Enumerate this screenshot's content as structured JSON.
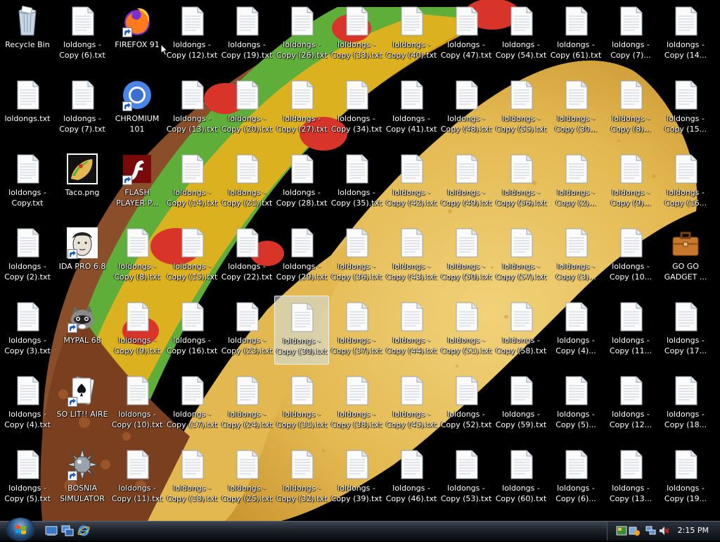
{
  "desktop": {
    "icons": [
      {
        "label": "Recycle Bin",
        "type": "bin",
        "shortcut": false,
        "col": 0,
        "row": 0
      },
      {
        "label": "loldongs -\nCopy (6).txt",
        "type": "txt",
        "shortcut": false,
        "col": 1,
        "row": 0
      },
      {
        "label": "FIREFOX 91",
        "type": "firefox",
        "shortcut": true,
        "col": 2,
        "row": 0
      },
      {
        "label": "loldongs -\nCopy (12).txt",
        "type": "txt",
        "shortcut": false,
        "col": 3,
        "row": 0
      },
      {
        "label": "loldongs -\nCopy (19).txt",
        "type": "txt",
        "shortcut": false,
        "col": 4,
        "row": 0
      },
      {
        "label": "loldongs -\nCopy (26).txt",
        "type": "txt",
        "shortcut": false,
        "col": 5,
        "row": 0
      },
      {
        "label": "loldongs -\nCopy (33).txt",
        "type": "txt",
        "shortcut": false,
        "col": 6,
        "row": 0
      },
      {
        "label": "loldongs -\nCopy (40).txt",
        "type": "txt",
        "shortcut": false,
        "col": 7,
        "row": 0
      },
      {
        "label": "loldongs -\nCopy (47).txt",
        "type": "txt",
        "shortcut": false,
        "col": 8,
        "row": 0
      },
      {
        "label": "loldongs -\nCopy (54).txt",
        "type": "txt",
        "shortcut": false,
        "col": 9,
        "row": 0
      },
      {
        "label": "loldongs -\nCopy (61).txt",
        "type": "txt",
        "shortcut": false,
        "col": 10,
        "row": 0
      },
      {
        "label": "loldongs -\nCopy (7)...",
        "type": "txt",
        "shortcut": false,
        "col": 11,
        "row": 0
      },
      {
        "label": "loldongs -\nCopy (14...",
        "type": "txt",
        "shortcut": false,
        "col": 12,
        "row": 0
      },
      {
        "label": "loldongs.txt",
        "type": "txt",
        "shortcut": false,
        "col": 0,
        "row": 1
      },
      {
        "label": "loldongs -\nCopy (7).txt",
        "type": "txt",
        "shortcut": false,
        "col": 1,
        "row": 1
      },
      {
        "label": "CHROMIUM\n101",
        "type": "chromium",
        "shortcut": true,
        "col": 2,
        "row": 1
      },
      {
        "label": "loldongs -\nCopy (13).txt",
        "type": "txt",
        "shortcut": false,
        "col": 3,
        "row": 1
      },
      {
        "label": "loldongs -\nCopy (20).txt",
        "type": "txt",
        "shortcut": false,
        "col": 4,
        "row": 1
      },
      {
        "label": "loldongs -\nCopy (27).txt",
        "type": "txt",
        "shortcut": false,
        "col": 5,
        "row": 1
      },
      {
        "label": "loldongs -\nCopy (34).txt",
        "type": "txt",
        "shortcut": false,
        "col": 6,
        "row": 1
      },
      {
        "label": "loldongs -\nCopy (41).txt",
        "type": "txt",
        "shortcut": false,
        "col": 7,
        "row": 1
      },
      {
        "label": "loldongs -\nCopy (48).txt",
        "type": "txt",
        "shortcut": false,
        "col": 8,
        "row": 1
      },
      {
        "label": "loldongs -\nCopy (55).txt",
        "type": "txt",
        "shortcut": false,
        "col": 9,
        "row": 1
      },
      {
        "label": "loldongs -\nCopy (30...",
        "type": "txt",
        "shortcut": false,
        "col": 10,
        "row": 1
      },
      {
        "label": "loldongs -\nCopy (8)...",
        "type": "txt",
        "shortcut": false,
        "col": 11,
        "row": 1
      },
      {
        "label": "loldongs -\nCopy (15...",
        "type": "txt",
        "shortcut": false,
        "col": 12,
        "row": 1
      },
      {
        "label": "loldongs -\nCopy.txt",
        "type": "txt",
        "shortcut": false,
        "col": 0,
        "row": 2
      },
      {
        "label": "Taco.png",
        "type": "taco",
        "shortcut": false,
        "col": 1,
        "row": 2
      },
      {
        "label": "FLASH\nPLAYER P...",
        "type": "flash",
        "shortcut": true,
        "col": 2,
        "row": 2
      },
      {
        "label": "loldongs -\nCopy (14).txt",
        "type": "txt",
        "shortcut": false,
        "col": 3,
        "row": 2
      },
      {
        "label": "loldongs -\nCopy (21).txt",
        "type": "txt",
        "shortcut": false,
        "col": 4,
        "row": 2
      },
      {
        "label": "loldongs -\nCopy (28).txt",
        "type": "txt",
        "shortcut": false,
        "col": 5,
        "row": 2
      },
      {
        "label": "loldongs -\nCopy (35).txt",
        "type": "txt",
        "shortcut": false,
        "col": 6,
        "row": 2
      },
      {
        "label": "loldongs -\nCopy (42).txt",
        "type": "txt",
        "shortcut": false,
        "col": 7,
        "row": 2
      },
      {
        "label": "loldongs -\nCopy (49).txt",
        "type": "txt",
        "shortcut": false,
        "col": 8,
        "row": 2
      },
      {
        "label": "loldongs -\nCopy (56).txt",
        "type": "txt",
        "shortcut": false,
        "col": 9,
        "row": 2
      },
      {
        "label": "loldongs -\nCopy (2)...",
        "type": "txt",
        "shortcut": false,
        "col": 10,
        "row": 2
      },
      {
        "label": "loldongs -\nCopy (9)...",
        "type": "txt",
        "shortcut": false,
        "col": 11,
        "row": 2
      },
      {
        "label": "loldongs -\nCopy (16...",
        "type": "txt",
        "shortcut": false,
        "col": 12,
        "row": 2
      },
      {
        "label": "loldongs -\nCopy (2).txt",
        "type": "txt",
        "shortcut": false,
        "col": 0,
        "row": 3
      },
      {
        "label": "IDA PRO 6.8",
        "type": "ida",
        "shortcut": true,
        "col": 1,
        "row": 3
      },
      {
        "label": "loldongs -\nCopy (8).txt",
        "type": "txt",
        "shortcut": false,
        "col": 2,
        "row": 3
      },
      {
        "label": "loldongs -\nCopy (15).txt",
        "type": "txt",
        "shortcut": false,
        "col": 3,
        "row": 3
      },
      {
        "label": "loldongs -\nCopy (22).txt",
        "type": "txt",
        "shortcut": false,
        "col": 4,
        "row": 3
      },
      {
        "label": "loldongs -\nCopy (29).txt",
        "type": "txt",
        "shortcut": false,
        "col": 5,
        "row": 3
      },
      {
        "label": "loldongs -\nCopy (36).txt",
        "type": "txt",
        "shortcut": false,
        "col": 6,
        "row": 3
      },
      {
        "label": "loldongs -\nCopy (43).txt",
        "type": "txt",
        "shortcut": false,
        "col": 7,
        "row": 3
      },
      {
        "label": "loldongs -\nCopy (50).txt",
        "type": "txt",
        "shortcut": false,
        "col": 8,
        "row": 3
      },
      {
        "label": "loldongs -\nCopy (57).txt",
        "type": "txt",
        "shortcut": false,
        "col": 9,
        "row": 3
      },
      {
        "label": "loldongs -\nCopy (3)...",
        "type": "txt",
        "shortcut": false,
        "col": 10,
        "row": 3
      },
      {
        "label": "loldongs -\nCopy (10...",
        "type": "txt",
        "shortcut": false,
        "col": 11,
        "row": 3
      },
      {
        "label": "GO GO\nGADGET ...",
        "type": "briefcase",
        "shortcut": false,
        "col": 12,
        "row": 3
      },
      {
        "label": "loldongs -\nCopy (3).txt",
        "type": "txt",
        "shortcut": false,
        "col": 0,
        "row": 4
      },
      {
        "label": "MYPAL 68",
        "type": "mypal",
        "shortcut": true,
        "col": 1,
        "row": 4
      },
      {
        "label": "loldongs -\nCopy (9).txt",
        "type": "txt",
        "shortcut": false,
        "col": 2,
        "row": 4
      },
      {
        "label": "loldongs -\nCopy (16).txt",
        "type": "txt",
        "shortcut": false,
        "col": 3,
        "row": 4
      },
      {
        "label": "loldongs -\nCopy (23).txt",
        "type": "txt",
        "shortcut": false,
        "col": 4,
        "row": 4
      },
      {
        "label": "loldongs -\nCopy (30).txt",
        "type": "txt",
        "shortcut": false,
        "col": 5,
        "row": 4,
        "selected": true
      },
      {
        "label": "loldongs -\nCopy (37).txt",
        "type": "txt",
        "shortcut": false,
        "col": 6,
        "row": 4
      },
      {
        "label": "loldongs -\nCopy (44).txt",
        "type": "txt",
        "shortcut": false,
        "col": 7,
        "row": 4
      },
      {
        "label": "loldongs -\nCopy (51).txt",
        "type": "txt",
        "shortcut": false,
        "col": 8,
        "row": 4
      },
      {
        "label": "loldongs -\nCopy (58).txt",
        "type": "txt",
        "shortcut": false,
        "col": 9,
        "row": 4
      },
      {
        "label": "loldongs -\nCopy (4)...",
        "type": "txt",
        "shortcut": false,
        "col": 10,
        "row": 4
      },
      {
        "label": "loldongs -\nCopy (11...",
        "type": "txt",
        "shortcut": false,
        "col": 11,
        "row": 4
      },
      {
        "label": "loldongs -\nCopy (17...",
        "type": "txt",
        "shortcut": false,
        "col": 12,
        "row": 4
      },
      {
        "label": "loldongs -\nCopy (4).txt",
        "type": "txt",
        "shortcut": false,
        "col": 0,
        "row": 5
      },
      {
        "label": "SO LIT!! AIRE",
        "type": "solitaire",
        "shortcut": true,
        "col": 1,
        "row": 5
      },
      {
        "label": "loldongs -\nCopy (10).txt",
        "type": "txt",
        "shortcut": false,
        "col": 2,
        "row": 5
      },
      {
        "label": "loldongs -\nCopy (17).txt",
        "type": "txt",
        "shortcut": false,
        "col": 3,
        "row": 5
      },
      {
        "label": "loldongs -\nCopy (24).txt",
        "type": "txt",
        "shortcut": false,
        "col": 4,
        "row": 5
      },
      {
        "label": "loldongs -\nCopy (31).txt",
        "type": "txt",
        "shortcut": false,
        "col": 5,
        "row": 5
      },
      {
        "label": "loldongs -\nCopy (38).txt",
        "type": "txt",
        "shortcut": false,
        "col": 6,
        "row": 5
      },
      {
        "label": "loldongs -\nCopy (45).txt",
        "type": "txt",
        "shortcut": false,
        "col": 7,
        "row": 5
      },
      {
        "label": "loldongs -\nCopy (52).txt",
        "type": "txt",
        "shortcut": false,
        "col": 8,
        "row": 5
      },
      {
        "label": "loldongs -\nCopy (59).txt",
        "type": "txt",
        "shortcut": false,
        "col": 9,
        "row": 5
      },
      {
        "label": "loldongs -\nCopy (5)...",
        "type": "txt",
        "shortcut": false,
        "col": 10,
        "row": 5
      },
      {
        "label": "loldongs -\nCopy (12...",
        "type": "txt",
        "shortcut": false,
        "col": 11,
        "row": 5
      },
      {
        "label": "loldongs -\nCopy (18...",
        "type": "txt",
        "shortcut": false,
        "col": 12,
        "row": 5
      },
      {
        "label": "loldongs -\nCopy (5).txt",
        "type": "txt",
        "shortcut": false,
        "col": 0,
        "row": 6
      },
      {
        "label": "BOSNIA\nSIMULATOR",
        "type": "bosnia",
        "shortcut": true,
        "col": 1,
        "row": 6
      },
      {
        "label": "loldongs -\nCopy (11).txt",
        "type": "txt",
        "shortcut": false,
        "col": 2,
        "row": 6
      },
      {
        "label": "loldongs -\nCopy (18).txt",
        "type": "txt",
        "shortcut": false,
        "col": 3,
        "row": 6
      },
      {
        "label": "loldongs -\nCopy (25).txt",
        "type": "txt",
        "shortcut": false,
        "col": 4,
        "row": 6
      },
      {
        "label": "loldongs -\nCopy (32).txt",
        "type": "txt",
        "shortcut": false,
        "col": 5,
        "row": 6
      },
      {
        "label": "loldongs -\nCopy (39).txt",
        "type": "txt",
        "shortcut": false,
        "col": 6,
        "row": 6
      },
      {
        "label": "loldongs -\nCopy (46).txt",
        "type": "txt",
        "shortcut": false,
        "col": 7,
        "row": 6
      },
      {
        "label": "loldongs -\nCopy (53).txt",
        "type": "txt",
        "shortcut": false,
        "col": 8,
        "row": 6
      },
      {
        "label": "loldongs -\nCopy (60).txt",
        "type": "txt",
        "shortcut": false,
        "col": 9,
        "row": 6
      },
      {
        "label": "loldongs -\nCopy (6)...",
        "type": "txt",
        "shortcut": false,
        "col": 10,
        "row": 6
      },
      {
        "label": "loldongs -\nCopy (13...",
        "type": "txt",
        "shortcut": false,
        "col": 11,
        "row": 6
      },
      {
        "label": "loldongs -\nCopy (19...",
        "type": "txt",
        "shortcut": false,
        "col": 12,
        "row": 6
      }
    ]
  },
  "taskbar": {
    "start_icon": "windows-orb-icon",
    "quick_launch": [
      "show-desktop-icon",
      "switch-windows-icon",
      "internet-explorer-icon"
    ],
    "tray_icons": [
      "network-icon",
      "volume-muted-icon"
    ],
    "clock": "2:15 PM"
  },
  "colors": {
    "desktop_background": "#000000",
    "taco_shell": "#e8c25a",
    "lettuce": "#5fae3a",
    "tomato": "#d8342a",
    "cheese": "#f2b21c"
  }
}
